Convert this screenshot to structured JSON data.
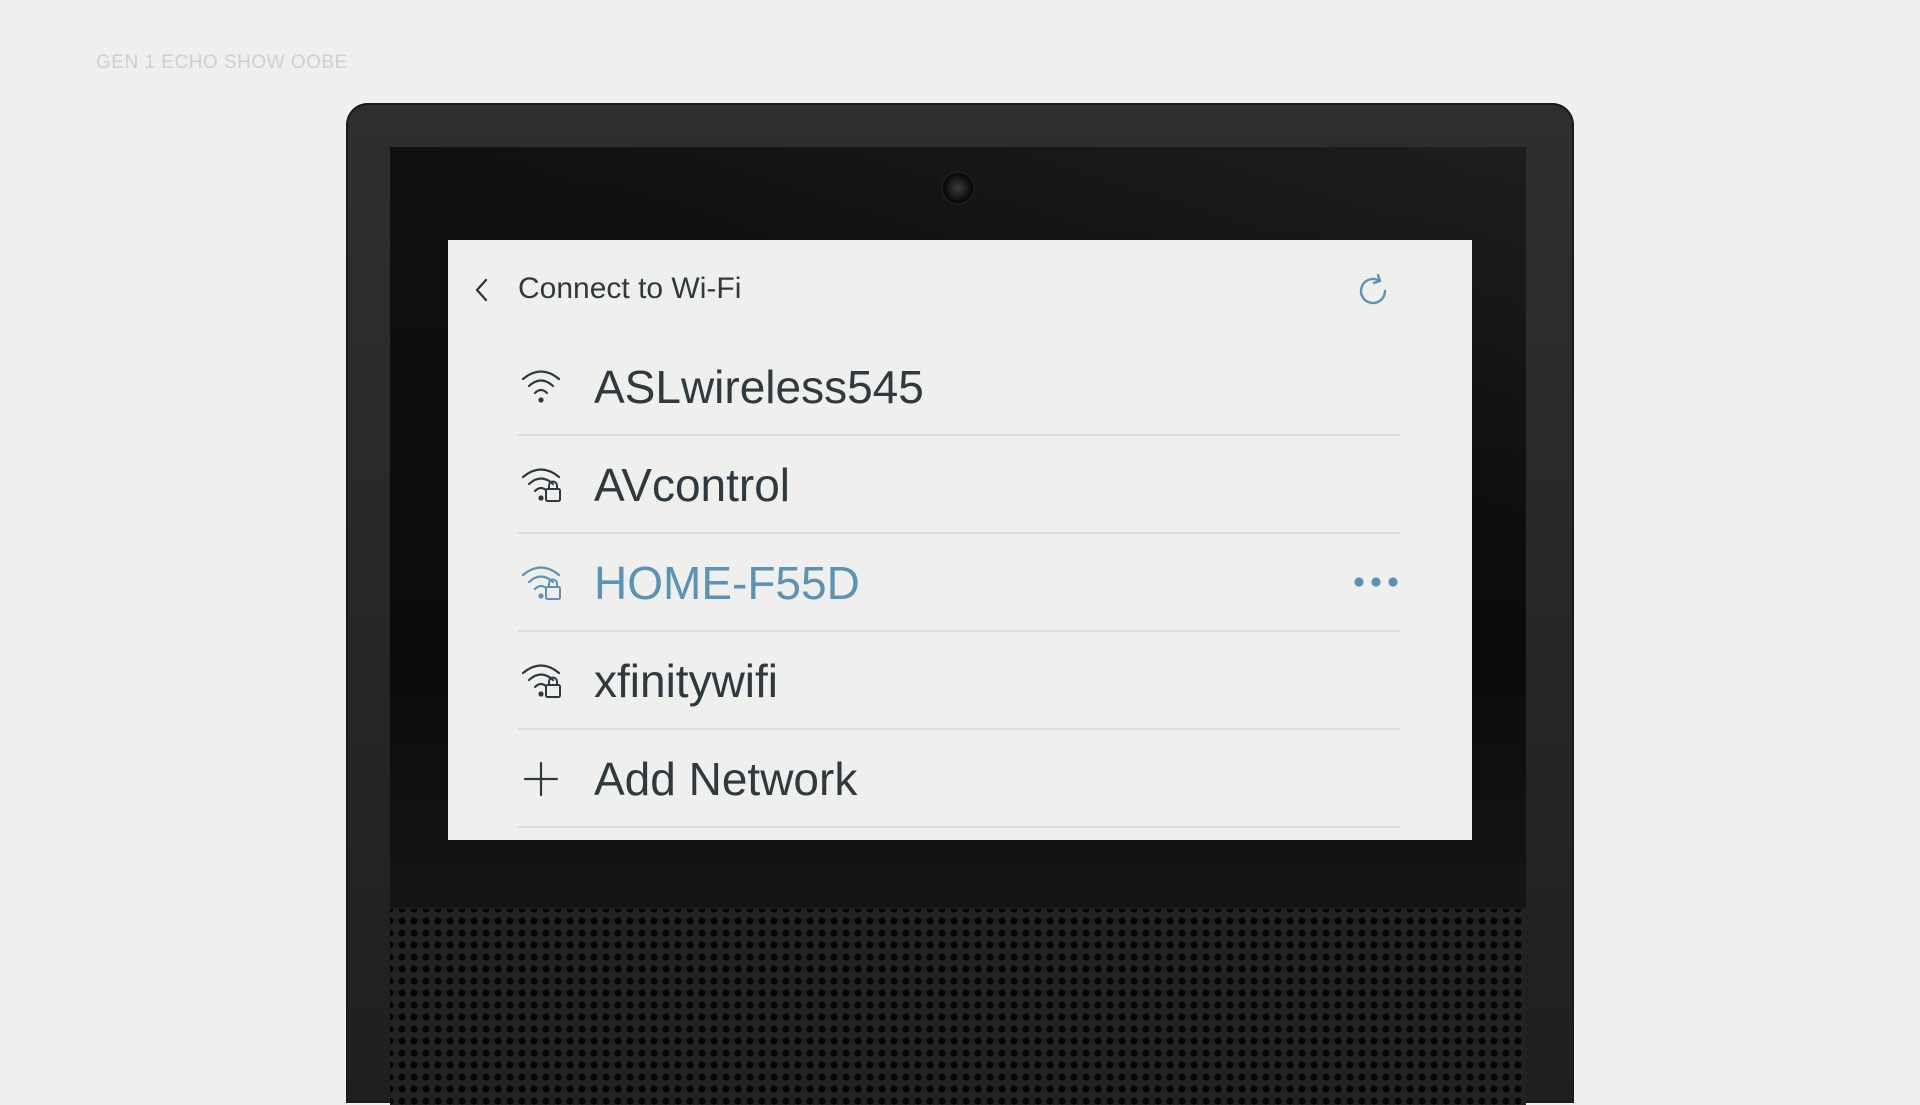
{
  "caption": "GEN 1 ECHO SHOW OOBE",
  "screen": {
    "title": "Connect to Wi-Fi",
    "back_icon": "chevron-left-icon",
    "refresh_icon": "refresh-icon"
  },
  "networks": [
    {
      "name": "ASLwireless545",
      "icon": "wifi-icon",
      "secured": false,
      "selected": false
    },
    {
      "name": "AVcontrol",
      "icon": "wifi-lock-icon",
      "secured": true,
      "selected": false
    },
    {
      "name": "HOME-F55D",
      "icon": "wifi-lock-icon",
      "secured": true,
      "selected": true,
      "more_icon": "more-horizontal-icon"
    },
    {
      "name": "xfinitywifi",
      "icon": "wifi-lock-icon",
      "secured": true,
      "selected": false
    }
  ],
  "add_network": {
    "label": "Add Network",
    "icon": "plus-icon"
  },
  "colors": {
    "text": "#2e3a40",
    "accent": "#5b93b5",
    "screen_bg": "#efefed",
    "page_bg": "#efefef",
    "divider": "#dcdcdc"
  }
}
